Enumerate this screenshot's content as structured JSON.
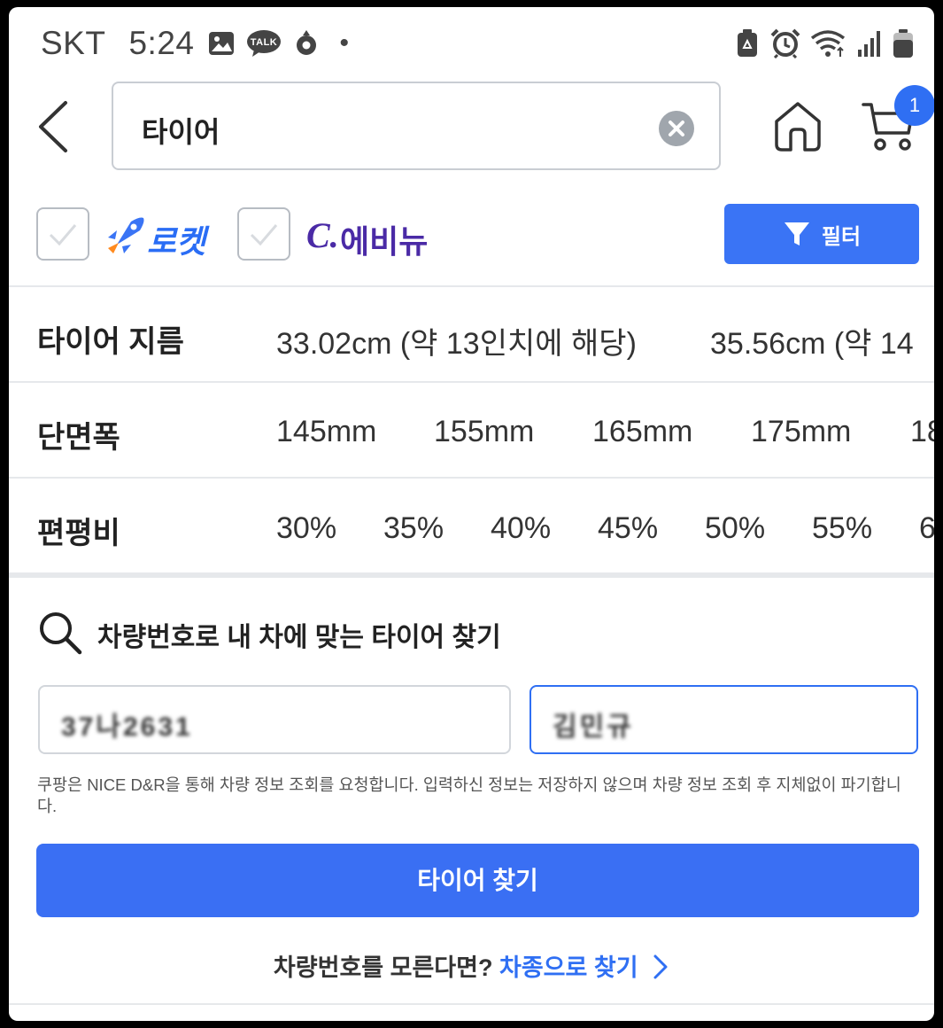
{
  "status_bar": {
    "carrier": "SKT",
    "time": "5:24",
    "dot": "•",
    "talk_badge": "TALK",
    "left_icons": [
      "gallery-icon",
      "kakaotalk-icon",
      "location-icon"
    ],
    "right_icons": [
      "battery-saver-icon",
      "alarm-icon",
      "wifi-icon",
      "signal-icon",
      "battery-icon"
    ]
  },
  "header": {
    "search_value": "타이어",
    "cart_count": "1"
  },
  "filters": {
    "rocket_label": "로켓",
    "evenew_c": "C.",
    "evenew_label": "에비뉴",
    "filter_button": "필터"
  },
  "tire_rows": [
    {
      "label": "타이어 지름",
      "values": [
        "33.02cm (약 13인치에 해당)",
        "35.56cm (약 14"
      ]
    },
    {
      "label": "단면폭",
      "values": [
        "145mm",
        "155mm",
        "165mm",
        "175mm",
        "18"
      ]
    },
    {
      "label": "편평비",
      "values": [
        "30%",
        "35%",
        "40%",
        "45%",
        "50%",
        "55%",
        "6"
      ]
    }
  ],
  "plate_search": {
    "title": "차량번호로 내 차에 맞는 타이어 찾기",
    "plate_value_1": "37나2631",
    "plate_value_2": "김민규",
    "notice": "쿠팡은 NICE D&R을 통해 차량 정보 조회를 요청합니다. 입력하신 정보는 저장하지 않으며 차량 정보 조회 후 지체없이 파기합니다.",
    "find_button": "타이어 찾기",
    "bottom_question": "차량번호를 모른다면?",
    "bottom_link": "차종으로 찾기"
  },
  "colors": {
    "accent": "#2f6ff3",
    "filter_button": "#3a74f5",
    "evenew": "#4a2aa6"
  }
}
